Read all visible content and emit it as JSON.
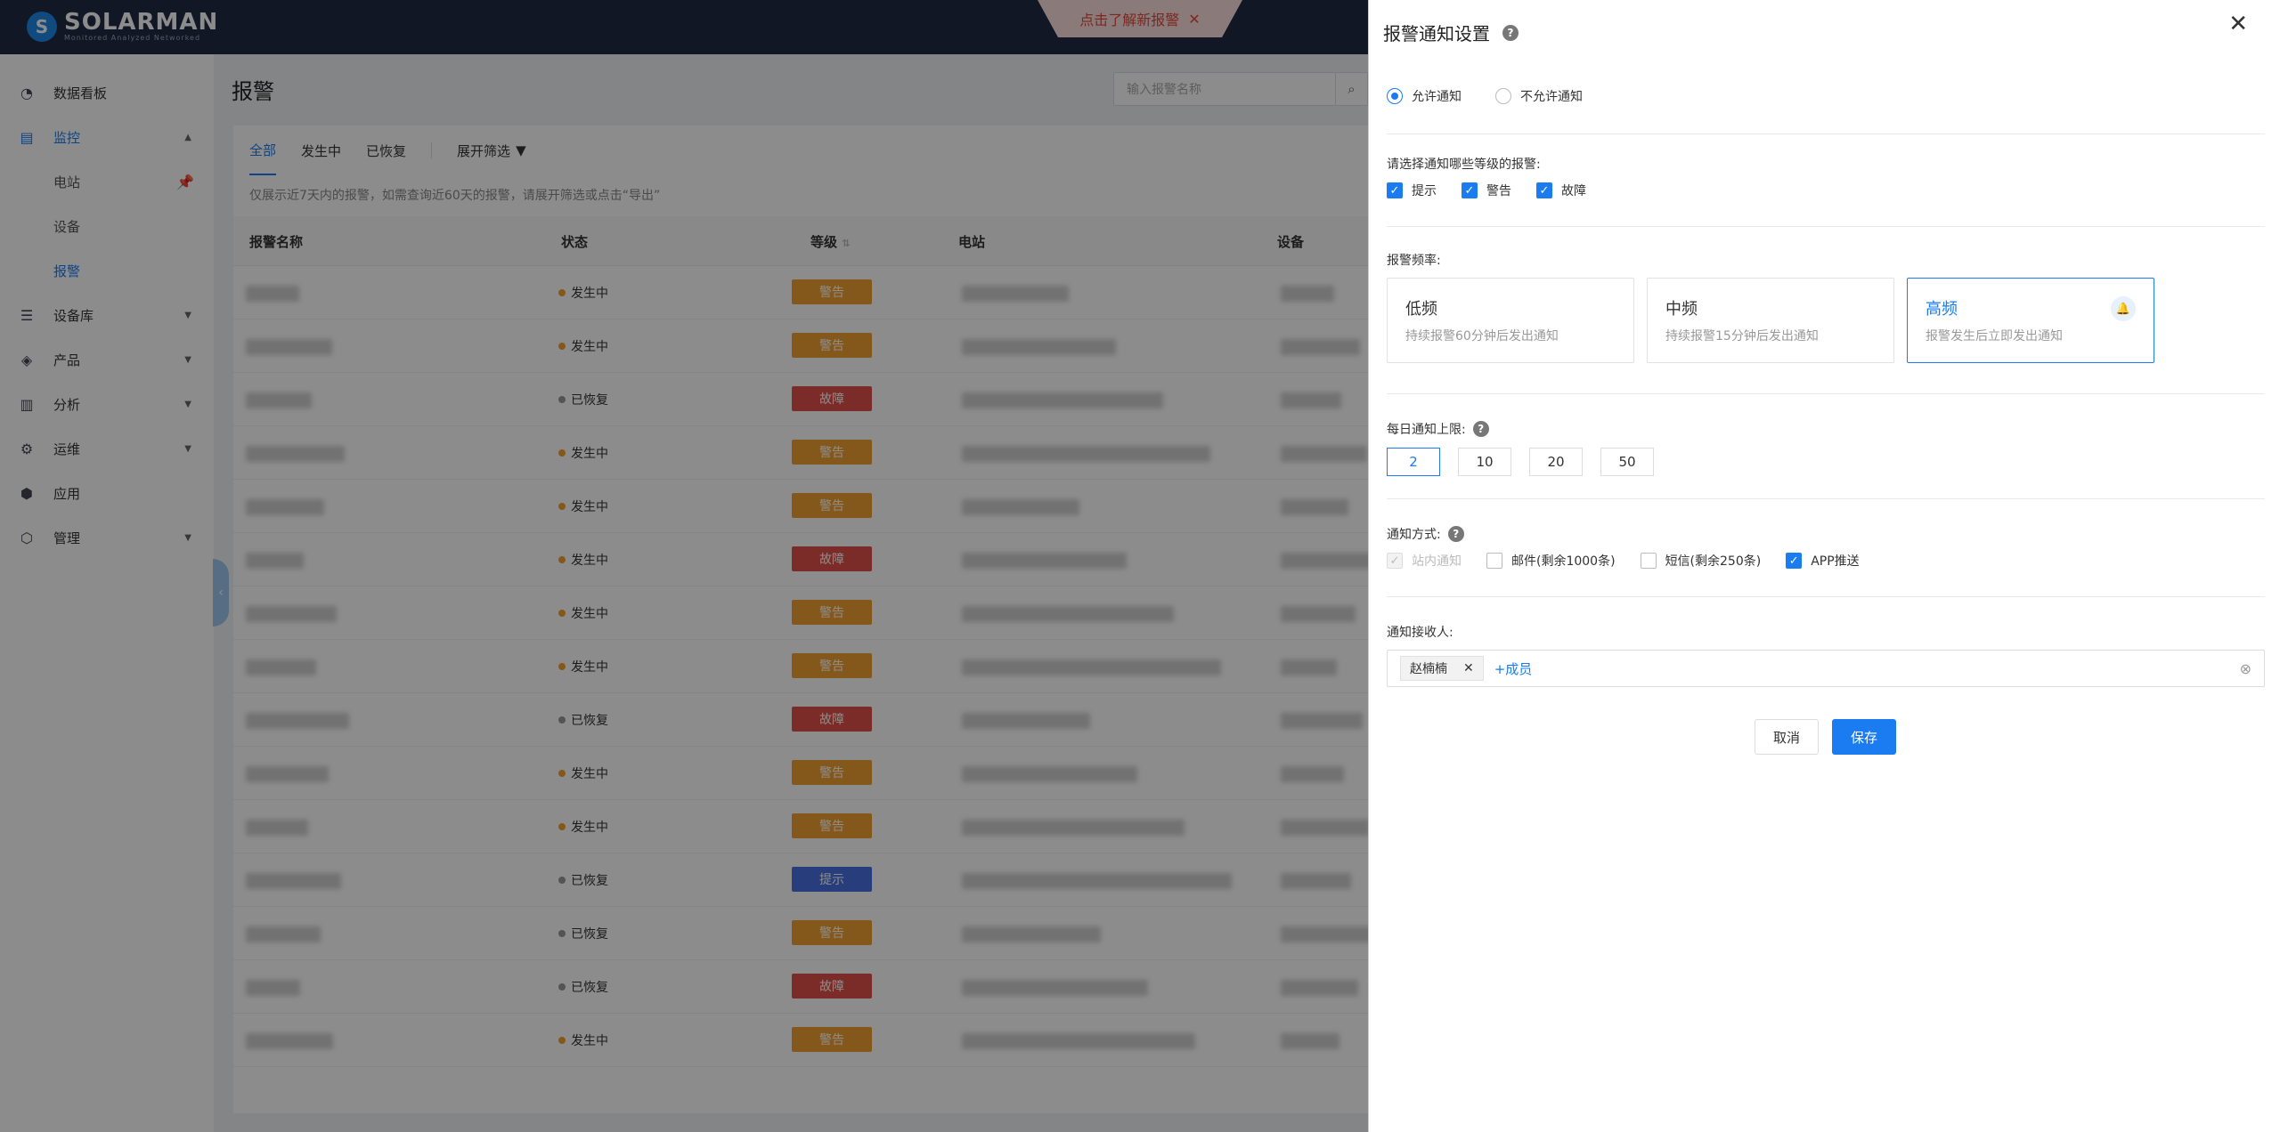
{
  "app": {
    "logo": "SOLARMAN",
    "logo_sub": "Monitored Analyzed Networked",
    "notice": "点击了解新报警",
    "notice_close": "✕"
  },
  "sidebar": {
    "items": [
      {
        "label": "数据看板",
        "icon": "dashboard-icon"
      },
      {
        "label": "监控",
        "icon": "monitor-icon"
      },
      {
        "label": "电站"
      },
      {
        "label": "设备"
      },
      {
        "label": "报警"
      },
      {
        "label": "设备库",
        "icon": "device-library-icon"
      },
      {
        "label": "产品",
        "icon": "product-icon"
      },
      {
        "label": "分析",
        "icon": "analysis-icon"
      },
      {
        "label": "运维",
        "icon": "maintenance-icon"
      },
      {
        "label": "应用",
        "icon": "apps-icon"
      },
      {
        "label": "管理",
        "icon": "manage-icon"
      }
    ]
  },
  "page": {
    "title": "报警",
    "search_placeholder": "输入报警名称",
    "tabs": [
      "全部",
      "发生中",
      "已恢复"
    ],
    "filter": "展开筛选",
    "hint": "仅展示近7天内的报警，如需查询近60天的报警，请展开筛选或点击“导出”",
    "columns": [
      "报警名称",
      "状态",
      "等级",
      "电站",
      "设备"
    ]
  },
  "table": {
    "rows": [
      {
        "status": "发生中",
        "level": "警告"
      },
      {
        "status": "发生中",
        "level": "警告"
      },
      {
        "status": "已恢复",
        "level": "故障"
      },
      {
        "status": "发生中",
        "level": "警告"
      },
      {
        "status": "发生中",
        "level": "警告"
      },
      {
        "status": "发生中",
        "level": "故障"
      },
      {
        "status": "发生中",
        "level": "警告"
      },
      {
        "status": "发生中",
        "level": "警告"
      },
      {
        "status": "已恢复",
        "level": "故障"
      },
      {
        "status": "发生中",
        "level": "警告"
      },
      {
        "status": "发生中",
        "level": "警告"
      },
      {
        "status": "已恢复",
        "level": "提示"
      },
      {
        "status": "已恢复",
        "level": "警告"
      },
      {
        "status": "已恢复",
        "level": "故障"
      },
      {
        "status": "发生中",
        "level": "警告"
      }
    ]
  },
  "colors": {
    "accent": "#1a7cf0",
    "warning": "#f0a030",
    "fault": "#e0504a",
    "info": "#4a6fe0",
    "active_dot": "#f0a030",
    "recovered_dot": "#999999"
  },
  "panel": {
    "title": "报警通知设置",
    "help": "?",
    "close": "✕",
    "allow": "允许通知",
    "disallow": "不允许通知",
    "levels_label": "请选择通知哪些等级的报警:",
    "levels": [
      "提示",
      "警告",
      "故障"
    ],
    "freq_label": "报警频率:",
    "freq": [
      {
        "title": "低频",
        "desc": "持续报警60分钟后发出通知"
      },
      {
        "title": "中频",
        "desc": "持续报警15分钟后发出通知"
      },
      {
        "title": "高频",
        "desc": "报警发生后立即发出通知"
      }
    ],
    "limit_label": "每日通知上限:",
    "limits": [
      "2",
      "10",
      "20",
      "50"
    ],
    "method_label": "通知方式:",
    "methods": [
      "站内通知",
      "邮件(剩余1000条)",
      "短信(剩余250条)",
      "APP推送"
    ],
    "recv_label": "通知接收人:",
    "recipient": "赵楠楠",
    "add_member": "+成员",
    "cancel": "取消",
    "save": "保存"
  }
}
